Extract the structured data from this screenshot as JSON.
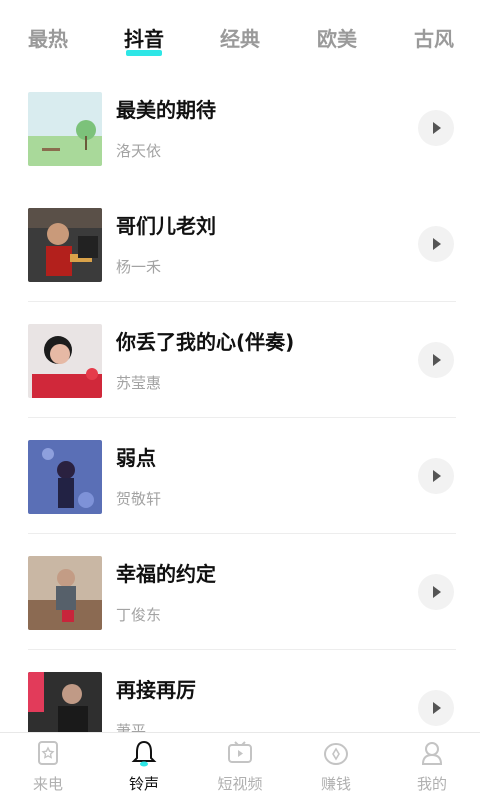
{
  "tabs": [
    {
      "label": "最热",
      "active": false
    },
    {
      "label": "抖音",
      "active": true
    },
    {
      "label": "经典",
      "active": false
    },
    {
      "label": "欧美",
      "active": false
    },
    {
      "label": "古风",
      "active": false
    }
  ],
  "colors": {
    "accent": "#2ee6e6",
    "title": "#111111",
    "subtitle": "#a3a3a3",
    "tab_inactive": "#9a9a9a",
    "play_bg": "#f2f2f2"
  },
  "songs": [
    {
      "title": "最美的期待",
      "artist": "洛天依"
    },
    {
      "title": "哥们儿老刘",
      "artist": "杨一禾"
    },
    {
      "title": "你丢了我的心(伴奏)",
      "artist": "苏莹惠"
    },
    {
      "title": "弱点",
      "artist": "贺敬轩"
    },
    {
      "title": "幸福的约定",
      "artist": "丁俊东"
    },
    {
      "title": "再接再厉",
      "artist": "萧平"
    }
  ],
  "bottom_nav": [
    {
      "label": "来电",
      "icon": "phone-card-icon",
      "active": false
    },
    {
      "label": "铃声",
      "icon": "bell-icon",
      "active": true
    },
    {
      "label": "短视频",
      "icon": "video-icon",
      "active": false
    },
    {
      "label": "赚钱",
      "icon": "coin-icon",
      "active": false
    },
    {
      "label": "我的",
      "icon": "profile-icon",
      "active": false
    }
  ]
}
